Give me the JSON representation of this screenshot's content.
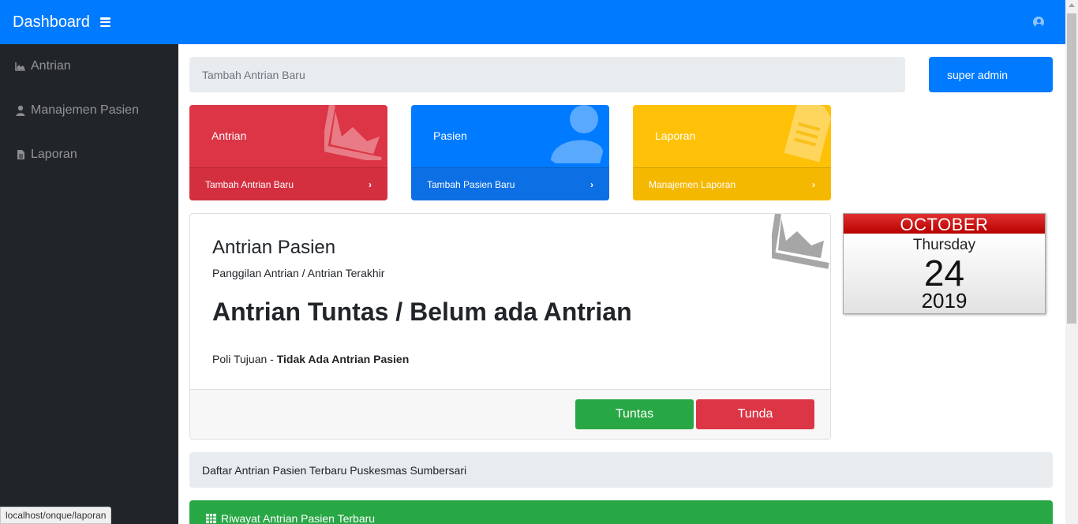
{
  "navbar": {
    "brand": "Dashboard",
    "menu_icon": "hamburger-icon",
    "user_icon": "user-circle-icon"
  },
  "sidebar": {
    "items": [
      {
        "label": "Antrian",
        "icon": "area-chart-icon"
      },
      {
        "label": "Manajemen Pasien",
        "icon": "user-icon"
      },
      {
        "label": "Laporan",
        "icon": "file-icon"
      }
    ]
  },
  "breadcrumb": {
    "text": "Tambah Antrian Baru"
  },
  "admin_button": {
    "label": "super admin"
  },
  "cards": [
    {
      "title": "Antrian",
      "footer": "Tambah Antrian Baru",
      "icon": "area-chart-icon",
      "color": "#dc3545"
    },
    {
      "title": "Pasien",
      "footer": "Tambah Pasien Baru",
      "icon": "user-icon",
      "color": "#007bff"
    },
    {
      "title": "Laporan",
      "footer": "Manajemen Laporan",
      "icon": "file-text-icon",
      "color": "#ffc107"
    }
  ],
  "queue_panel": {
    "title": "Antrian Pasien",
    "subtitle": "Panggilan Antrian / Antrian Terakhir",
    "status": "Antrian Tuntas / Belum ada Antrian",
    "poli_label": "Poli Tujuan - ",
    "poli_value": "Tidak Ada Antrian Pasien",
    "done_button": "Tuntas",
    "delay_button": "Tunda"
  },
  "calendar": {
    "month": "OCTOBER",
    "weekday": "Thursday",
    "day": "24",
    "year": "2019"
  },
  "list_title": "Daftar Antrian Pasien Terbaru Puskesmas Sumbersari",
  "history_title": "Riwayat Antrian Pasien Terbaru",
  "status_bar_url": "localhost/onque/laporan",
  "colors": {
    "primary": "#007bff",
    "danger": "#dc3545",
    "warning": "#ffc107",
    "success": "#28a745",
    "sidebar": "#212529"
  }
}
